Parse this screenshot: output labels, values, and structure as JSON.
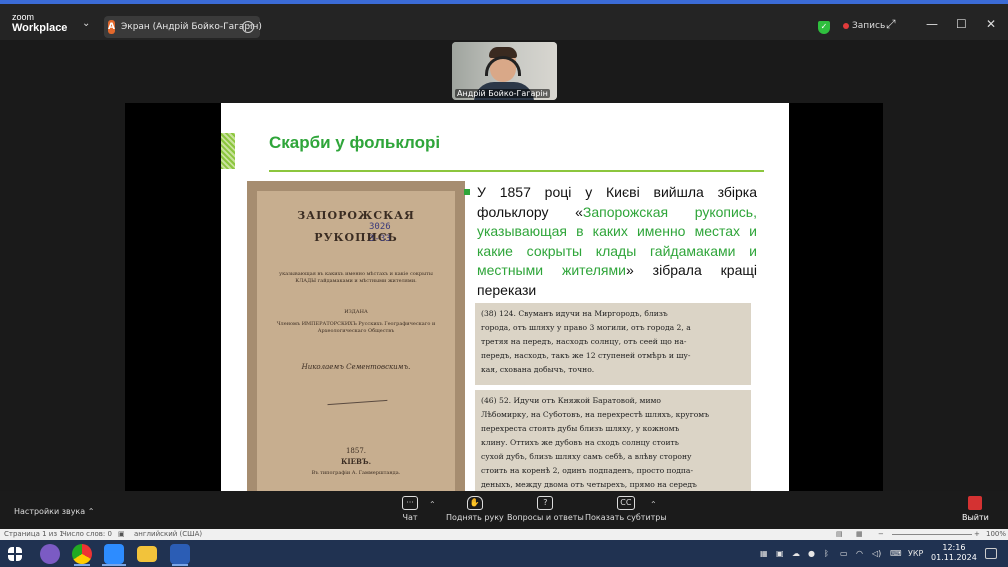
{
  "zoom": {
    "logo_line1": "zoom",
    "logo_line2": "Workplace",
    "share_avatar": "A",
    "share_label": "Экран (Андрій Бойко-Гагарін)",
    "record_label": "Запись",
    "participant_name": "Андрій Бойко-Гагарін",
    "audio_settings": "Настройки звука",
    "toolbar": {
      "chat": "Чат",
      "raise_hand": "Поднять руку",
      "qa": "Вопросы и ответы",
      "captions": "Показать субтитры",
      "exit": "Выйти"
    }
  },
  "slide": {
    "title": "Скарби у фольклорі",
    "bullet_pre": "У 1857 році у Києві вийшла збірка фольклору «",
    "bullet_highlight": "Запорожская рукопись, указывающая в каких именно местах и какие сокрыты клады гайдамаками и местными жителями",
    "bullet_post": "» зібрала кращі перекази",
    "book": {
      "line1": "ЗАПОРОЖСКАЯ",
      "line2": "РУКОПИСЬ",
      "hand": "3026\n3-33",
      "line3": "указывающая въ какихъ именно мѣстахъ и какіе сокрыты КЛАДЫ гайдамаками и мѣстными жителями.",
      "line4": "ИЗДАНА",
      "line5": "Членомъ ИМПЕРАТОРСКИХЪ Русскихъ Географическаго и Археологическаго Обществъ",
      "line6": "Николаемъ Сементовскимъ.",
      "line7": "1857.",
      "line8": "КІЕВЪ.",
      "line9": "Въ типографіи А. Гаммерштанда."
    },
    "scan1": [
      "(38) 124. Свуманъ идучи на Миргородъ, близъ",
      "города, отъ шляху у право 3 могили, отъ города 2, а",
      "третяя на передъ, насходъ солнцу, отъ сеей що на-",
      "передъ, насходъ, такъ же 12 ступеней отмѣръ и шу-",
      "кая, схована добычъ, точно."
    ],
    "scan2": [
      "(46) 52. Идучи отъ Княжой Баратовой, мимо",
      "Лѣбомирку, на Суботовъ, на перехрестѣ шляхъ, кругомъ",
      "перехреста стоять дубы близъ шляху, у кожномъ",
      "клину. Оттихъ же дубовъ на сходъ солнцу стоить",
      "сухой дубъ, близъ шляху самъ себѣ, а влѣву сторону",
      "стоить на коренѣ 2, одинъ подпаденъ, просто подпа-",
      "деныхъ, между двома отъ четырехъ, прямо на середъ"
    ]
  },
  "word_status": {
    "page": "Страница 1 из 1",
    "words": "Число слов: 0",
    "lang": "английский (США)",
    "zoom": "100%"
  },
  "taskbar": {
    "lang": "УКР",
    "time": "12:16",
    "date": "01.11.2024"
  },
  "colors": {
    "accent_green": "#2fa53a",
    "zoom_blue": "#3b6bd6",
    "exit_red": "#d43232"
  }
}
